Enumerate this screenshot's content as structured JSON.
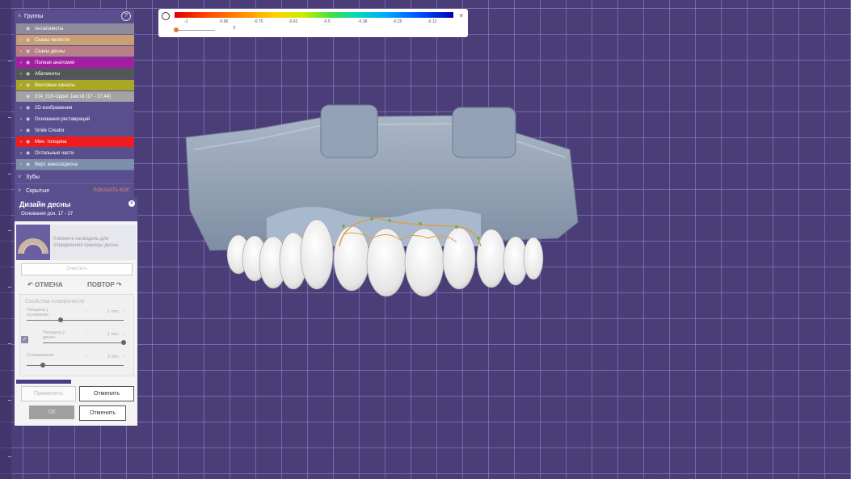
{
  "groups": {
    "title": "Группы",
    "help": "?",
    "items": [
      {
        "label": "Антагонисты",
        "color": "#8e8b9c",
        "expandable": false
      },
      {
        "label": "Сканы челюсти",
        "color": "#c99f75",
        "expandable": true
      },
      {
        "label": "Сканы десны",
        "color": "#b88086",
        "expandable": true
      },
      {
        "label": "Полная анатомия",
        "color": "#a21ea2",
        "expandable": true
      },
      {
        "label": "Абатменты",
        "color": "#555555",
        "expandable": true
      },
      {
        "label": "Винтовые каналы",
        "color": "#a8a826",
        "expandable": true
      },
      {
        "label": "014_016-Upper Jaw.stl (17 - 27.44)",
        "color": "#a3a3a6",
        "expandable": false
      },
      {
        "label": "2D-изображения",
        "color": "#5a4f8e",
        "expandable": true
      },
      {
        "label": "Основания реставраций",
        "color": "#5a4f8e",
        "expandable": true
      },
      {
        "label": "Smile Creator",
        "color": "#5a4f8e",
        "expandable": true
      },
      {
        "label": "Мин. толщина",
        "color": "#ee1c1c",
        "expandable": true
      },
      {
        "label": "Остальные части",
        "color": "#5a4f8e",
        "expandable": true
      },
      {
        "label": "Вирт. вакоса/десна",
        "color": "#7d8faa",
        "expandable": true
      }
    ],
    "teeth_label": "Зубы",
    "hidden_label": "Скрытые",
    "show_all": "ПОКАЗАТЬ ВСЕ"
  },
  "design": {
    "title": "Дизайн десны",
    "subtitle": "Основание дсн. 17 - 27",
    "hint": "Кликните на модель для определения границы десны",
    "clear_label": "Очистить",
    "undo_label": "ОТМЕНА",
    "redo_label": "ПОВТОР",
    "surface_title": "Свойства поверхности",
    "thickness_base_label": "Толщина у основания",
    "thickness_base_value": "1 mm",
    "thickness_base_level": 0.35,
    "thickness_tooth_label": "Толщина у десен",
    "thickness_tooth_value": "1 mm",
    "thickness_tooth_level": 1.0,
    "smoothing_label": "Сглаживание",
    "smoothing_value": "2 mm",
    "smoothing_level": 0.17,
    "apply_label": "Применить",
    "cancel_label": "Отменить",
    "ok_label": "ОК",
    "cancel2_label": "Отменить"
  },
  "scale": {
    "ticks": [
      "-1",
      "-0.86",
      "-0.75",
      "-0.62",
      "-0.5",
      "-0.38",
      "-0.25",
      "-0.12"
    ],
    "question": "?"
  }
}
